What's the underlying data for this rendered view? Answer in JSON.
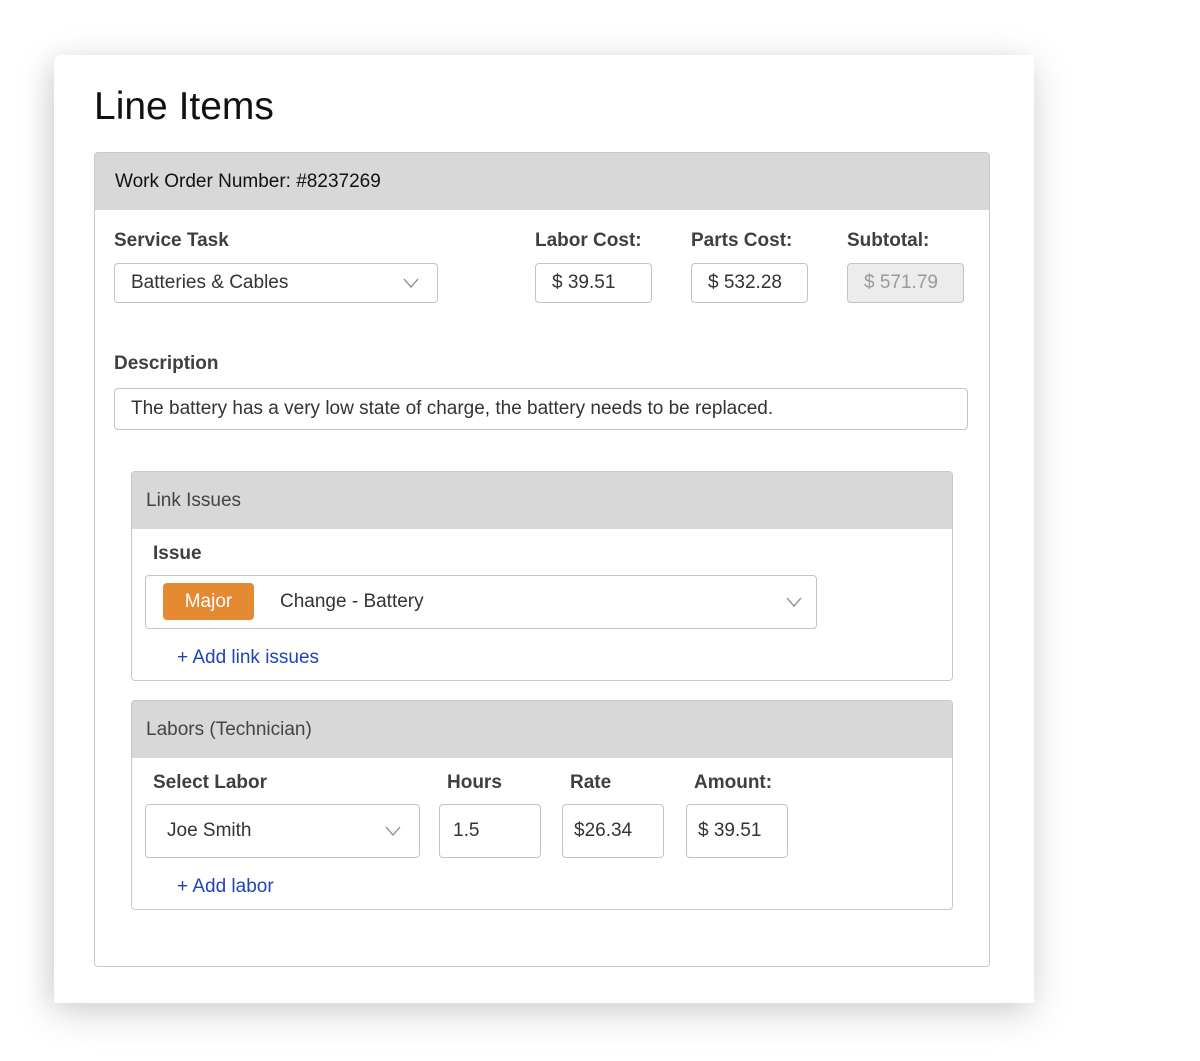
{
  "page": {
    "title": "Line Items"
  },
  "work_order": {
    "header": "Work Order Number: #8237269",
    "service_task": {
      "label": "Service Task",
      "value": "Batteries & Cables",
      "icon": "chevron-down-icon"
    },
    "labor_cost": {
      "label": "Labor Cost:",
      "value": "$ 39.51"
    },
    "parts_cost": {
      "label": "Parts Cost:",
      "value": "$ 532.28"
    },
    "subtotal": {
      "label": "Subtotal:",
      "value": "$ 571.79"
    },
    "description": {
      "label": "Description",
      "value": "The battery has a very low state of charge, the battery needs to be replaced."
    }
  },
  "link_issues": {
    "header": "Link Issues",
    "issue_label": "Issue",
    "issue": {
      "severity": "Major",
      "severity_color": "#e48a33",
      "name": "Change - Battery",
      "icon": "chevron-down-icon"
    },
    "add_link": "+ Add link issues"
  },
  "labors": {
    "header": "Labors (Technician)",
    "columns": {
      "select_labor": "Select Labor",
      "hours": "Hours",
      "rate": "Rate",
      "amount": "Amount:"
    },
    "row": {
      "labor": "Joe Smith",
      "hours": "1.5",
      "rate": "$26.34",
      "amount": "$ 39.51",
      "icon": "chevron-down-icon"
    },
    "add_link": "+ Add labor"
  }
}
